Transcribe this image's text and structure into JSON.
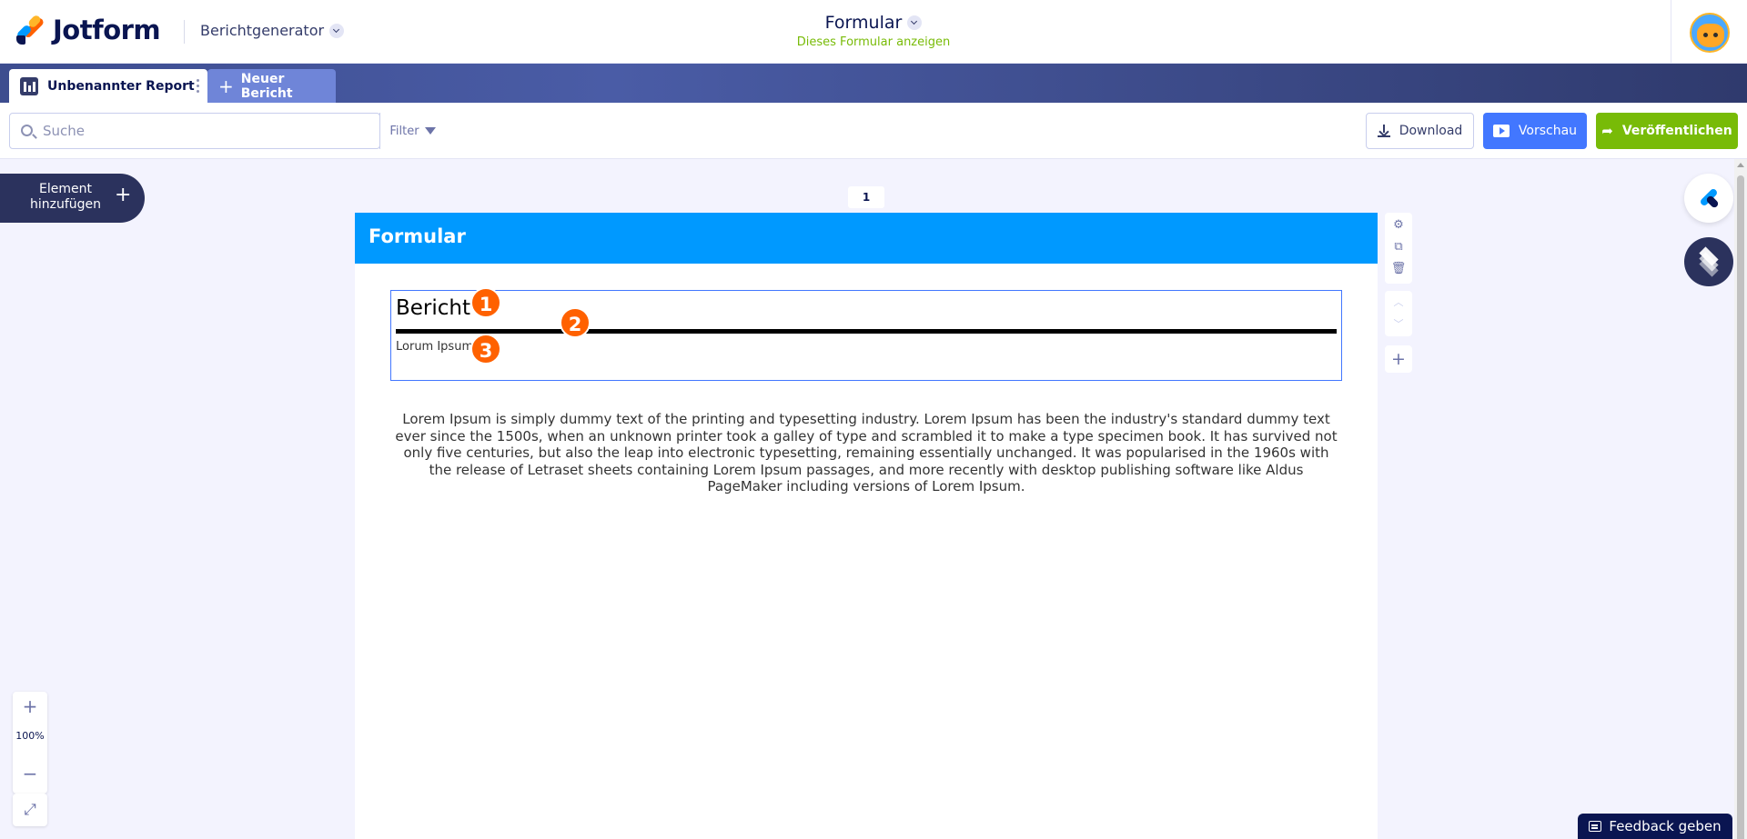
{
  "header": {
    "logo_text": "Jotform",
    "app_name": "Berichtgenerator",
    "form_title": "Formular",
    "form_subtitle": "Dieses Formular anzeigen"
  },
  "tabs": {
    "report_label": "Unbenannter Report",
    "new_label": "Neuer Bericht",
    "new_icon": "+"
  },
  "toolbar": {
    "search_placeholder": "Suche",
    "filter_label": "Filter",
    "download_label": "Download",
    "preview_label": "Vorschau",
    "publish_label": "Veröffentlichen"
  },
  "left_panel": {
    "add_element_label": "Element hinzufügen",
    "add_icon": "+",
    "zoom_in": "+",
    "zoom_level": "100%",
    "zoom_out": "−",
    "expand_icon": "⤢"
  },
  "canvas": {
    "page_number": "1",
    "page_header_title": "Formular",
    "heading": "Bericht",
    "subtext": "Lorum Ipsum",
    "paragraph": "Lorem Ipsum is simply dummy text of the printing and typesetting industry. Lorem Ipsum has been the industry's standard dummy text ever since the 1500s, when an unknown printer took a galley of type and scrambled it to make a type specimen book. It has survived not only five centuries, but also the leap into electronic typesetting, remaining essentially unchanged. It was popularised in the 1960s with the release of Letraset sheets containing Lorem Ipsum passages, and more recently with desktop publishing software like Aldus PageMaker including versions of Lorem Ipsum.",
    "markers": [
      "1",
      "2",
      "3"
    ]
  },
  "element_tools": {
    "settings": "⚙",
    "duplicate": "⧉",
    "delete": "🗑",
    "move_up": "︿",
    "move_down": "﹀",
    "add": "+"
  },
  "footer": {
    "feedback_label": "Feedback geben"
  },
  "colors": {
    "brand_navy": "#0a1551",
    "header_blue": "#0099ff",
    "preview_blue": "#4277ff",
    "publish_green": "#78bb07",
    "marker_orange": "#ff6100"
  }
}
